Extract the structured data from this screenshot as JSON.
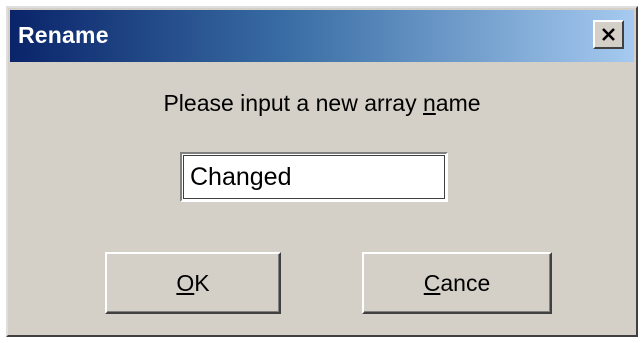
{
  "window": {
    "title": "Rename",
    "close_icon": "close-x-icon"
  },
  "prompt": {
    "before_mnemonic": "Please input a new array ",
    "mnemonic": "n",
    "after_mnemonic": "ame"
  },
  "name_input": {
    "value": "Changed"
  },
  "buttons": {
    "ok": {
      "mnemonic": "O",
      "rest": "K"
    },
    "cancel": {
      "mnemonic": "C",
      "rest": "ance"
    }
  },
  "colors": {
    "dialog_face": "#d4d0c8",
    "title_start": "#0a246a",
    "title_end": "#a6caf0"
  }
}
